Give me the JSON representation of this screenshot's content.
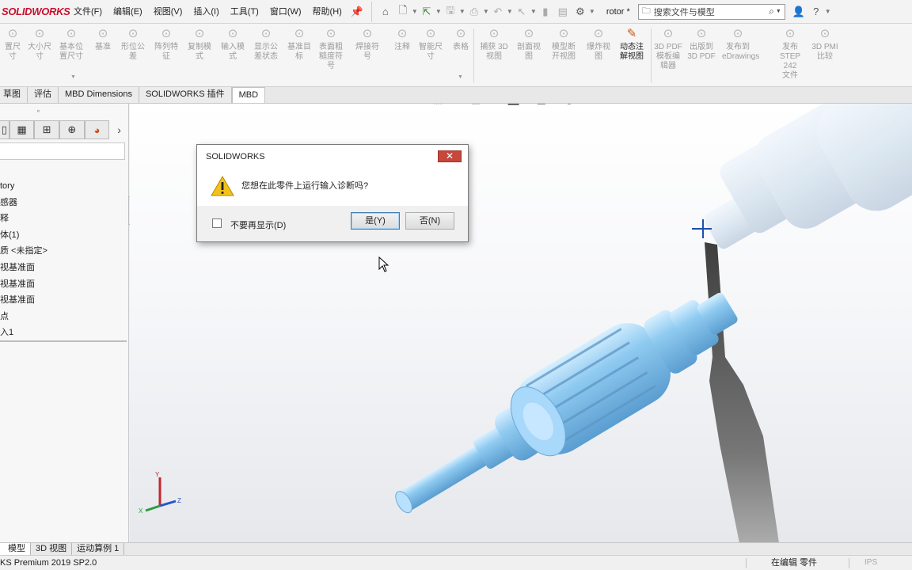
{
  "app": {
    "logo_text": "SOLIDWORKS",
    "document_name": "rotor *"
  },
  "menu": {
    "items": [
      "文件(F)",
      "编辑(E)",
      "视图(V)",
      "插入(I)",
      "工具(T)",
      "窗口(W)",
      "帮助(H)"
    ]
  },
  "search": {
    "placeholder": "搜索文件与模型"
  },
  "ribbon": {
    "buttons": [
      {
        "label": "置尺\n寸",
        "icon": "dimension-icon",
        "enabled": false
      },
      {
        "label": "大小尺\n寸",
        "icon": "size-dimension-icon",
        "enabled": false
      },
      {
        "label": "基本位\n置尺寸",
        "icon": "location-dimension-icon",
        "enabled": false
      },
      {
        "label": "基准",
        "icon": "datum-icon",
        "enabled": false
      },
      {
        "label": "形位公\n差",
        "icon": "geometric-tolerance-icon",
        "enabled": false
      },
      {
        "label": "阵列特\n征",
        "icon": "pattern-feature-icon",
        "enabled": false
      },
      {
        "label": "复制模\n式",
        "icon": "copy-scheme-icon",
        "enabled": false
      },
      {
        "label": "输入模\n式",
        "icon": "paste-scheme-icon",
        "enabled": false
      },
      {
        "label": "显示公\n差状态",
        "icon": "tolerance-status-icon",
        "enabled": false
      },
      {
        "label": "基准目\n标",
        "icon": "datum-target-icon",
        "enabled": false
      },
      {
        "label": "表面粗\n糙度符\n号",
        "icon": "surface-finish-icon",
        "enabled": false
      },
      {
        "label": "焊接符\n号",
        "icon": "weld-symbol-icon",
        "enabled": false
      },
      {
        "label": "注释",
        "icon": "note-icon",
        "enabled": false
      },
      {
        "label": "智能尺\n寸",
        "icon": "smart-dimension-icon",
        "enabled": false
      },
      {
        "label": "表格",
        "icon": "table-icon",
        "enabled": false
      },
      {
        "label": "捕获 3D\n视图",
        "icon": "capture-3d-view-icon",
        "enabled": false
      },
      {
        "label": "剖面视\n图",
        "icon": "section-view-icon",
        "enabled": false
      },
      {
        "label": "模型断\n开视图",
        "icon": "broken-view-icon",
        "enabled": false
      },
      {
        "label": "爆炸视\n图",
        "icon": "exploded-view-icon",
        "enabled": false
      },
      {
        "label": "动态注\n解视图",
        "icon": "dynamic-annotation-view-icon",
        "enabled": true
      },
      {
        "label": "3D PDF\n模板编\n辑器",
        "icon": "3d-pdf-template-icon",
        "enabled": false
      },
      {
        "label": "出版到\n3D PDF",
        "icon": "publish-3d-pdf-icon",
        "enabled": false
      },
      {
        "label": "发布到\neDrawings",
        "icon": "publish-edrawings-icon",
        "enabled": false
      },
      {
        "label": "发布\nSTEP 242\n文件",
        "icon": "publish-step-icon",
        "enabled": false
      },
      {
        "label": "3D PMI\n比较",
        "icon": "3d-pmi-compare-icon",
        "enabled": false
      }
    ]
  },
  "tabs": [
    {
      "label": "草图",
      "active": false
    },
    {
      "label": "评估",
      "active": false
    },
    {
      "label": "MBD Dimensions",
      "active": false
    },
    {
      "label": "SOLIDWORKS 插件",
      "active": false
    },
    {
      "label": "MBD",
      "active": true
    }
  ],
  "feature_tree": {
    "items": [
      "tory",
      "感器",
      "释",
      "体(1)",
      "质 <未指定>",
      "视基准面",
      "视基准面",
      "视基准面",
      "点",
      "入1"
    ]
  },
  "dialog": {
    "title": "SOLIDWORKS",
    "close_label": "✕",
    "message": "您想在此零件上运行输入诊断吗?",
    "checkbox_label": "不要再显示(D)",
    "checkbox_checked": false,
    "yes_label": "是(Y)",
    "no_label": "否(N)"
  },
  "bottom_tabs": [
    "模型",
    "3D 视图",
    "运动算例 1"
  ],
  "status": {
    "left": "KS Premium 2019 SP2.0",
    "edit_state": "在编辑 零件",
    "units": "IPS"
  },
  "triad": {
    "x_label": "X",
    "y_label": "Y",
    "z_label": "Z"
  },
  "colors": {
    "brand_red": "#c8102e",
    "part_blue": "#8fcaf0",
    "dialog_close": "#c7473b"
  }
}
